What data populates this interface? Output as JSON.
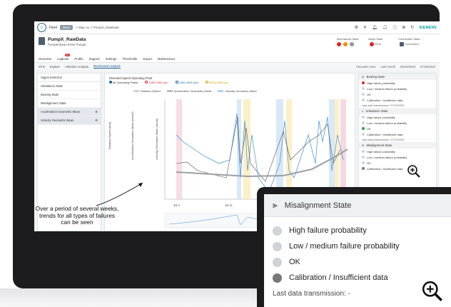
{
  "topbar": {
    "nav_label": "Fleet",
    "back_label": "Back",
    "breadcrumb": "> Map ov. > PumpX_RawData",
    "brand": "SIEMENS"
  },
  "header": {
    "asset_title": "PumpX_RawData",
    "asset_sub": "Pumpenhaus Erste Pumpe",
    "mech_state_label": "Mechanical State",
    "asset_state_label": "Asset State",
    "asset_state_value": "Error",
    "connection_state_label": "Connection State",
    "connection_state_value": "Connected"
  },
  "tabs": [
    "Overview",
    "Logbook",
    "Profile",
    "Support",
    "Settings",
    "Thresholds",
    "Export",
    "Maintenance"
  ],
  "logbook_badge": "99",
  "subtabs": [
    "KPIs",
    "Explore",
    "Vibration Analysis",
    "Mechanical Analysis"
  ],
  "subtab_right": [
    "Favourite view",
    "Last month",
    "06/16/2023",
    "07/16/2023"
  ],
  "left_panel": {
    "title": "Signal Selection",
    "items": [
      "Unbalance State",
      "Bearing State",
      "Misalignment State",
      "Acceleration Geometric Mean",
      "Velocity Geometric Mean"
    ]
  },
  "operating_points": {
    "title": "Detected Speed Operating Point",
    "options": [
      "All Operating Points",
      "1400-1500 rpm",
      "1500-1600 rpm",
      "1600-1800 rpm"
    ]
  },
  "chart_legend": [
    "Rotation Speed",
    "Acceleration Geometric Mean",
    "Velocity Geometric Mean"
  ],
  "axis_labels": {
    "y1": "Rotation Speed (rpm)",
    "y2": "Acceleration Geometric Mean (mm/s²)",
    "y3": "Velocity Geometric Mean (mm/s)"
  },
  "x_ticks": [
    "Jul 4",
    "Jul 11",
    "Jul 18"
  ],
  "right_panel": {
    "bearing": {
      "title": "Bearing State",
      "items": [
        "High failure probability",
        "Low / medium failure probability",
        "OK",
        "Calibration / Insufficient data"
      ],
      "last": "Last data transmission: 07/13/2023"
    },
    "unbalance": {
      "title": "Unbalance State",
      "items": [
        "High failure probability",
        "Low / medium failure probability",
        "OK",
        "Calibration / Insufficient data"
      ],
      "last": "Last data transmission: 07/13/2023"
    },
    "misalignment": {
      "title": "Misalignment State",
      "items": [
        "High failure probability",
        "Low / medium failure probability",
        "OK",
        "Calibration / Insufficient data"
      ]
    }
  },
  "annotation": "Over a period of several weeks, trends for all types of failures can be seen",
  "popup": {
    "title": "Misalignment State",
    "items": [
      "High failure probability",
      "Low / medium failure probability",
      "OK",
      "Calibration / Insufficient data"
    ],
    "last": "Last data transmission: -"
  },
  "colors": {
    "red": "#d9262c",
    "orange": "#f39200",
    "green": "#2e9e47",
    "grey": "#777777",
    "light_grey": "#cfd4d8",
    "accent": "#1f5f98"
  }
}
